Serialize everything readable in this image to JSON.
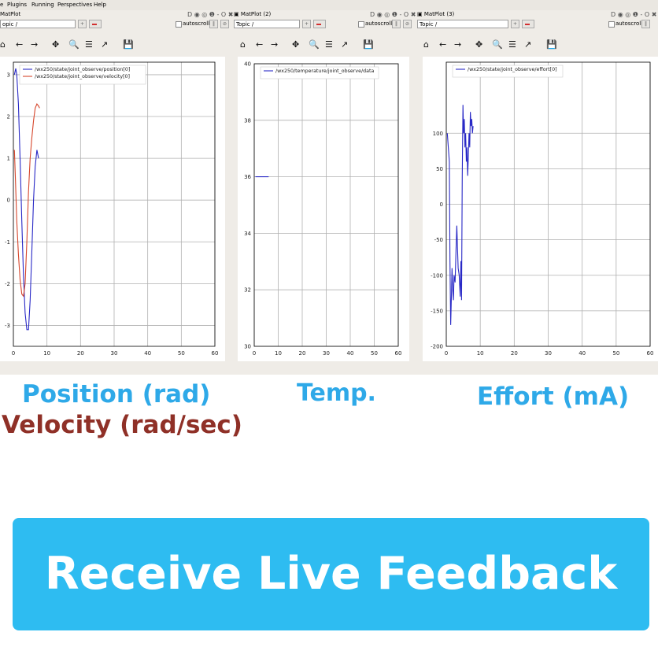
{
  "menu": [
    "e",
    "Plugins",
    "Running",
    "Perspectives",
    "Help"
  ],
  "panels": [
    {
      "title": "MatPlot",
      "topic_label": "opic /",
      "autoscroll_label": "autoscroll",
      "win_controls": "D ◉ ◎ ❶ - O ✖"
    },
    {
      "title": "MatPlot (2)",
      "topic_label": "Topic /",
      "autoscroll_label": "autoscroll",
      "win_controls": "D ◉ ◎ ❶ - O ✖"
    },
    {
      "title": "MatPlot (3)",
      "topic_label": "Topic /",
      "autoscroll_label": "autoscroll",
      "win_controls": "D ◉ ◎ ❶ - O ✖"
    }
  ],
  "toolbar_icons": [
    "home-icon",
    "back-arrow-icon",
    "forward-arrow-icon",
    "pan-icon",
    "zoom-icon",
    "configure-subplots-icon",
    "edit-axes-icon",
    "save-icon"
  ],
  "toolbar_glyphs": [
    "⌂",
    "←",
    "→",
    "✥",
    "🔍",
    "☰",
    "↗",
    "💾"
  ],
  "captions": {
    "position": "Position (rad)",
    "velocity": "Velocity (rad/sec)",
    "temp": "Temp.",
    "effort": "Effort (mA)"
  },
  "banner": {
    "text": "Receive Live Feedback"
  },
  "colors": {
    "caption_blue": "#2ea9e8",
    "caption_red": "#8f3027",
    "banner_bg": "#2ebcf1",
    "series_blue": "#2929c6",
    "series_red": "#d6462c"
  },
  "chart_data": [
    {
      "type": "line",
      "xlim": [
        0,
        60
      ],
      "ylim": [
        -3.5,
        3.3
      ],
      "xticks": [
        0,
        10,
        20,
        30,
        40,
        50,
        60
      ],
      "yticks": [
        -3,
        -2,
        -1,
        0,
        1,
        2,
        3
      ],
      "grid": true,
      "legend": "top-left",
      "series": [
        {
          "name": "/wx250/state/joint_observe/position[0]",
          "color": "#2929c6",
          "x": [
            0.3,
            0.7,
            1.0,
            1.5,
            2.0,
            2.5,
            3.0,
            3.5,
            4.0,
            4.5,
            5.0,
            5.5,
            6.0,
            6.5,
            7.0,
            7.5
          ],
          "y": [
            3.0,
            3.15,
            3.0,
            2.3,
            1.0,
            -0.5,
            -1.8,
            -2.7,
            -3.1,
            -3.1,
            -2.4,
            -1.2,
            0.0,
            0.8,
            1.2,
            1.0
          ]
        },
        {
          "name": "/wx250/state/joint_observe/velocity[0]",
          "color": "#d6462c",
          "x": [
            0.3,
            0.6,
            1.0,
            1.5,
            2.0,
            2.5,
            3.0,
            3.5,
            4.0,
            4.5,
            5.0,
            5.5,
            6.0,
            6.5,
            7.0,
            7.5,
            7.8
          ],
          "y": [
            1.2,
            0.5,
            -0.5,
            -1.3,
            -1.9,
            -2.25,
            -2.3,
            -2.0,
            -1.0,
            0.2,
            1.0,
            1.5,
            1.9,
            2.2,
            2.3,
            2.25,
            2.2
          ]
        }
      ]
    },
    {
      "type": "line",
      "xlim": [
        0,
        60
      ],
      "ylim": [
        30,
        40
      ],
      "xticks": [
        0,
        10,
        20,
        30,
        40,
        50,
        60
      ],
      "yticks": [
        30,
        32,
        34,
        36,
        38,
        40
      ],
      "grid": true,
      "legend": "top-left",
      "series": [
        {
          "name": "/wx250/temperature/joint_observe/data",
          "color": "#2929c6",
          "x": [
            0.5,
            6.0
          ],
          "y": [
            36,
            36
          ]
        }
      ]
    },
    {
      "type": "line",
      "xlim": [
        0,
        60
      ],
      "ylim": [
        -200,
        200
      ],
      "xticks": [
        0,
        10,
        20,
        30,
        40,
        50,
        60
      ],
      "yticks": [
        -200,
        -150,
        -100,
        -50,
        0,
        50,
        100
      ],
      "grid": true,
      "legend": "top-left",
      "series": [
        {
          "name": "/wx250/state/joint_observe/effort[0]",
          "color": "#2929c6",
          "x": [
            0.3,
            0.6,
            0.9,
            1.1,
            1.3,
            1.5,
            1.7,
            1.9,
            2.1,
            2.3,
            2.6,
            2.9,
            3.1,
            3.3,
            3.5,
            3.8,
            4.1,
            4.3,
            4.5,
            4.7,
            4.9,
            5.1,
            5.3,
            5.5,
            5.7,
            5.9,
            6.1,
            6.3,
            6.5,
            6.7,
            6.9,
            7.1,
            7.3,
            7.5,
            7.7,
            7.9
          ],
          "y": [
            100,
            80,
            60,
            -80,
            -170,
            -130,
            -90,
            -120,
            -135,
            -100,
            -110,
            -60,
            -30,
            -60,
            -90,
            -100,
            -130,
            -80,
            -135,
            40,
            140,
            100,
            120,
            80,
            100,
            60,
            80,
            40,
            70,
            100,
            80,
            130,
            110,
            120,
            100,
            110
          ]
        }
      ]
    }
  ]
}
